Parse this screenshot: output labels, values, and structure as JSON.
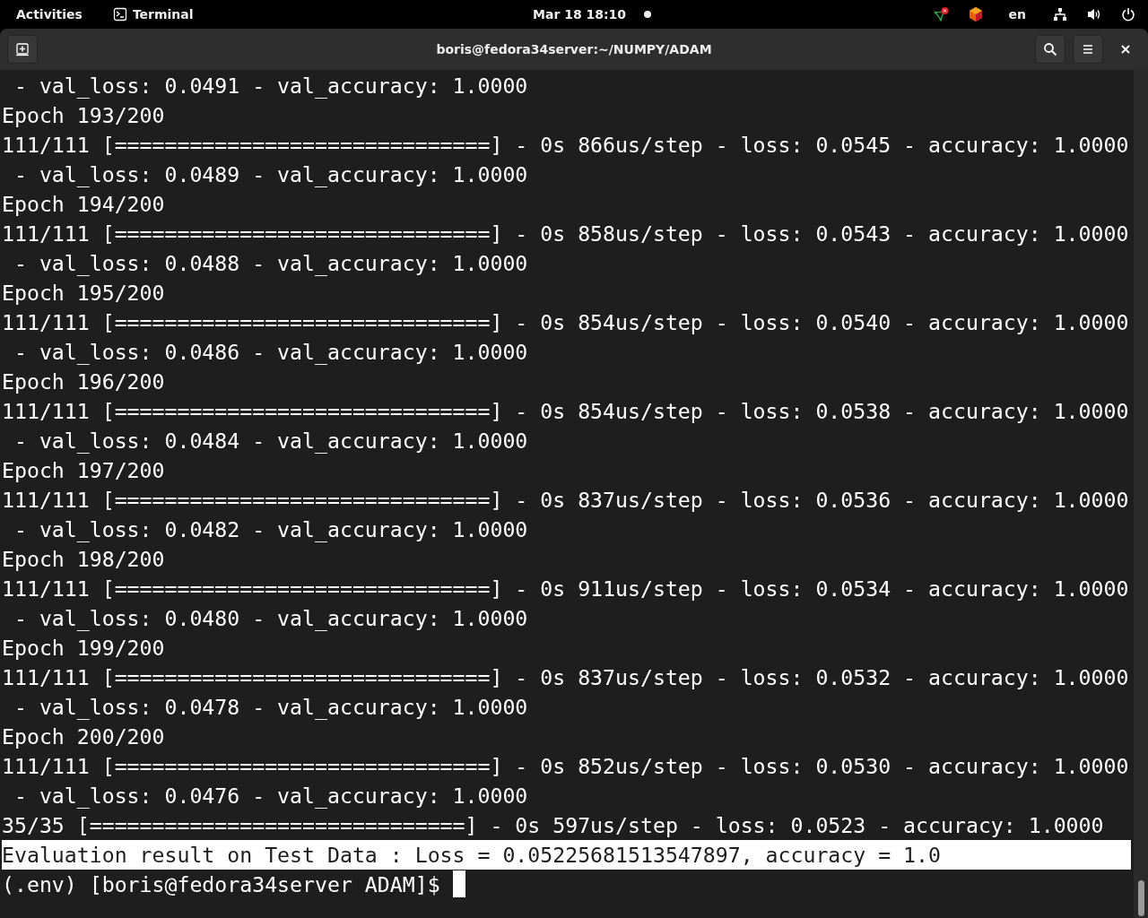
{
  "top_bar": {
    "activities": "Activities",
    "app_name": "Terminal",
    "clock": "Mar 18  18:10",
    "keyboard_layout": "en"
  },
  "window": {
    "title": "boris@fedora34server:~/NUMPY/ADAM"
  },
  "terminal": {
    "lines": [
      {
        "kind": "output",
        "text": " - val_loss: 0.0491 - val_accuracy: 1.0000",
        "selected": false
      },
      {
        "kind": "output",
        "text": "Epoch 193/200",
        "selected": false
      },
      {
        "kind": "output",
        "text": "111/111 [==============================] - 0s 866us/step - loss: 0.0545 - accuracy: 1.0000",
        "selected": false
      },
      {
        "kind": "output",
        "text": " - val_loss: 0.0489 - val_accuracy: 1.0000",
        "selected": false
      },
      {
        "kind": "output",
        "text": "Epoch 194/200",
        "selected": false
      },
      {
        "kind": "output",
        "text": "111/111 [==============================] - 0s 858us/step - loss: 0.0543 - accuracy: 1.0000",
        "selected": false
      },
      {
        "kind": "output",
        "text": " - val_loss: 0.0488 - val_accuracy: 1.0000",
        "selected": false
      },
      {
        "kind": "output",
        "text": "Epoch 195/200",
        "selected": false
      },
      {
        "kind": "output",
        "text": "111/111 [==============================] - 0s 854us/step - loss: 0.0540 - accuracy: 1.0000",
        "selected": false
      },
      {
        "kind": "output",
        "text": " - val_loss: 0.0486 - val_accuracy: 1.0000",
        "selected": false
      },
      {
        "kind": "output",
        "text": "Epoch 196/200",
        "selected": false
      },
      {
        "kind": "output",
        "text": "111/111 [==============================] - 0s 854us/step - loss: 0.0538 - accuracy: 1.0000",
        "selected": false
      },
      {
        "kind": "output",
        "text": " - val_loss: 0.0484 - val_accuracy: 1.0000",
        "selected": false
      },
      {
        "kind": "output",
        "text": "Epoch 197/200",
        "selected": false
      },
      {
        "kind": "output",
        "text": "111/111 [==============================] - 0s 837us/step - loss: 0.0536 - accuracy: 1.0000",
        "selected": false
      },
      {
        "kind": "output",
        "text": " - val_loss: 0.0482 - val_accuracy: 1.0000",
        "selected": false
      },
      {
        "kind": "output",
        "text": "Epoch 198/200",
        "selected": false
      },
      {
        "kind": "output",
        "text": "111/111 [==============================] - 0s 911us/step - loss: 0.0534 - accuracy: 1.0000",
        "selected": false
      },
      {
        "kind": "output",
        "text": " - val_loss: 0.0480 - val_accuracy: 1.0000",
        "selected": false
      },
      {
        "kind": "output",
        "text": "Epoch 199/200",
        "selected": false
      },
      {
        "kind": "output",
        "text": "111/111 [==============================] - 0s 837us/step - loss: 0.0532 - accuracy: 1.0000",
        "selected": false
      },
      {
        "kind": "output",
        "text": " - val_loss: 0.0478 - val_accuracy: 1.0000",
        "selected": false
      },
      {
        "kind": "output",
        "text": "Epoch 200/200",
        "selected": false
      },
      {
        "kind": "output",
        "text": "111/111 [==============================] - 0s 852us/step - loss: 0.0530 - accuracy: 1.0000",
        "selected": false
      },
      {
        "kind": "output",
        "text": " - val_loss: 0.0476 - val_accuracy: 1.0000",
        "selected": false
      },
      {
        "kind": "output",
        "text": "35/35 [==============================] - 0s 597us/step - loss: 0.0523 - accuracy: 1.0000",
        "selected": false
      },
      {
        "kind": "output",
        "text": "Evaluation result on Test Data : Loss = 0.05225681513547897, accuracy = 1.0",
        "selected": true
      },
      {
        "kind": "prompt",
        "text": "(.env) [boris@fedora34server ADAM]$ ",
        "selected": false
      }
    ]
  }
}
